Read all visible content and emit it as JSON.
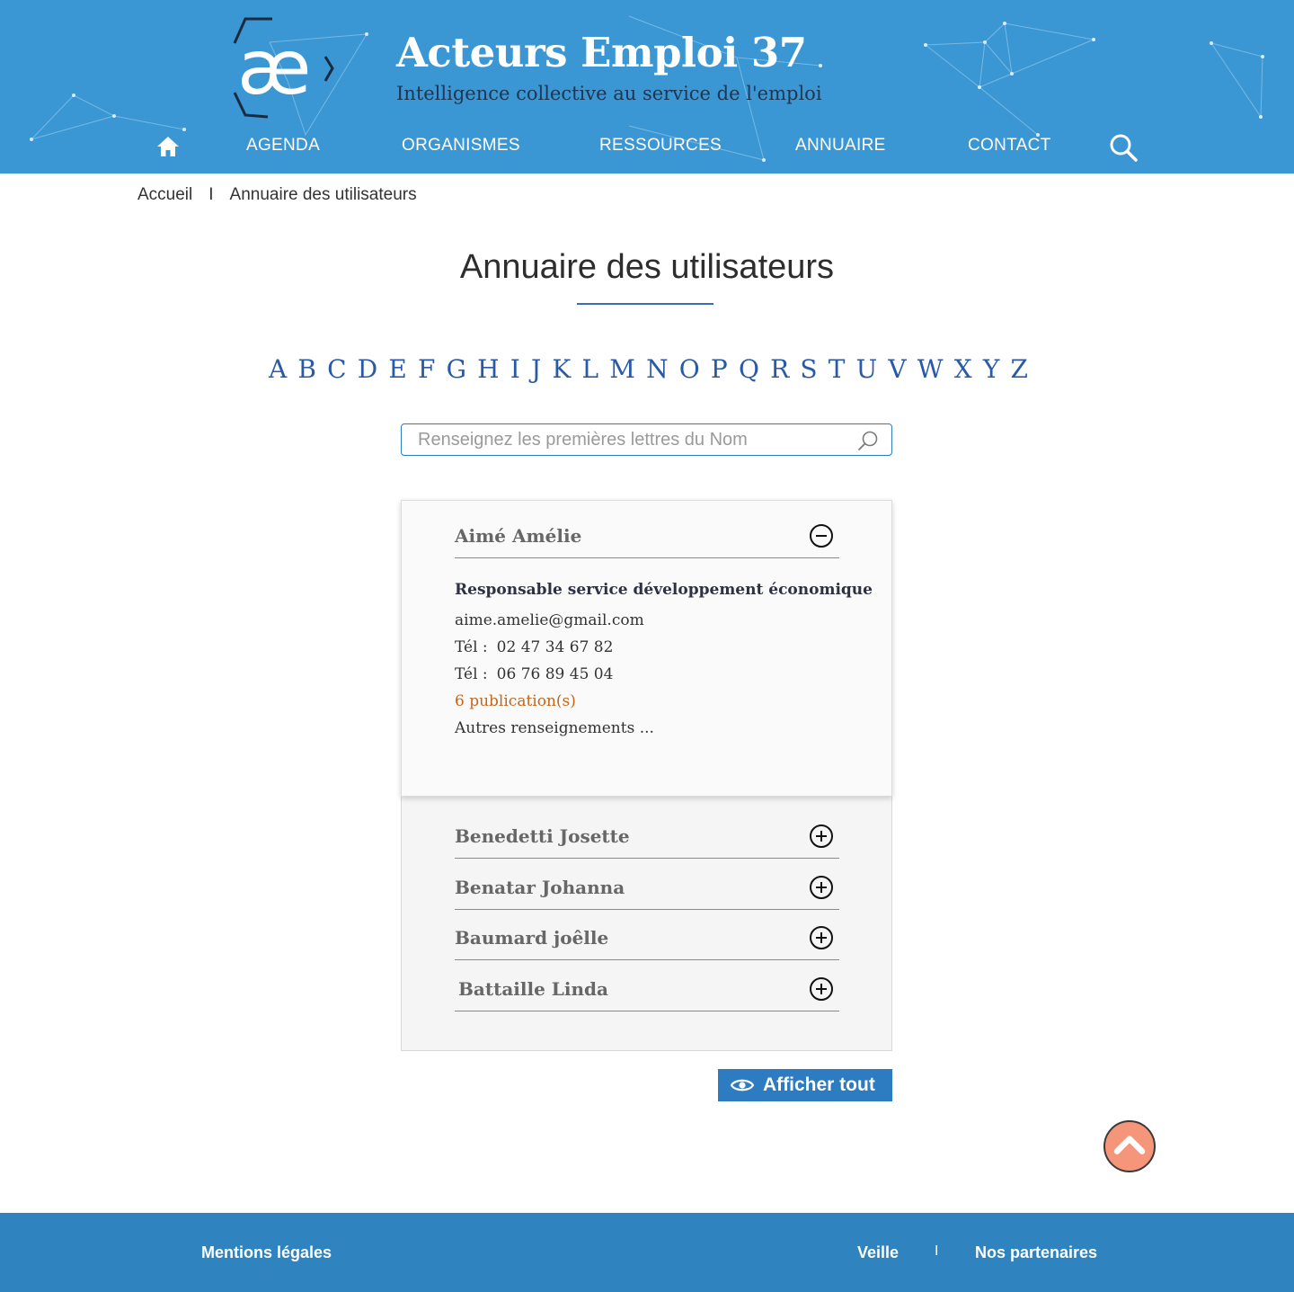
{
  "brand": {
    "title": "Acteurs Emploi 37",
    "subtitle": "Intelligence collective au service de l'emploi",
    "logo_text": "æ"
  },
  "nav": {
    "home_icon": "home-icon",
    "items": [
      "AGENDA",
      "ORGANISMES",
      "RESSOURCES",
      "ANNUAIRE",
      "CONTACT"
    ],
    "search_icon": "search-icon"
  },
  "breadcrumb": {
    "home": "Accueil",
    "separator": "I",
    "current": "Annuaire des utilisateurs"
  },
  "page_title": "Annuaire des utilisateurs",
  "alphabet": [
    "A",
    "B",
    "C",
    "D",
    "E",
    "F",
    "G",
    "H",
    "I",
    "J",
    "K",
    "L",
    "M",
    "N",
    "O",
    "P",
    "Q",
    "R",
    "S",
    "T",
    "U",
    "V",
    "W",
    "X",
    "Y",
    "Z"
  ],
  "search": {
    "placeholder": "Renseignez les premières lettres du Nom",
    "value": ""
  },
  "directory": {
    "expanded": {
      "name": "Aimé Amélie",
      "role": "Responsable service développement économique",
      "email": "aime.amelie@gmail.com",
      "phone_label": "Tél :",
      "phones": [
        "02 47 34 67 82",
        "06 76 89 45 04"
      ],
      "publications": "6 publication(s)",
      "more": "Autres renseignements ..."
    },
    "collapsed": [
      "Benedetti Josette",
      "Benatar Johanna",
      "Baumard joêlle",
      "Battaille Linda"
    ]
  },
  "show_all_label": "Afficher tout",
  "footer": {
    "legal": "Mentions légales",
    "watch": "Veille",
    "separator": "I",
    "partners": "Nos partenaires"
  },
  "colors": {
    "header_bg": "#3a97d4",
    "footer_bg": "#2f84c0",
    "accent": "#2d7bc0",
    "letter_link": "#2a5aa6",
    "publication": "#c4661c",
    "scroll_top": "#f5957a"
  }
}
